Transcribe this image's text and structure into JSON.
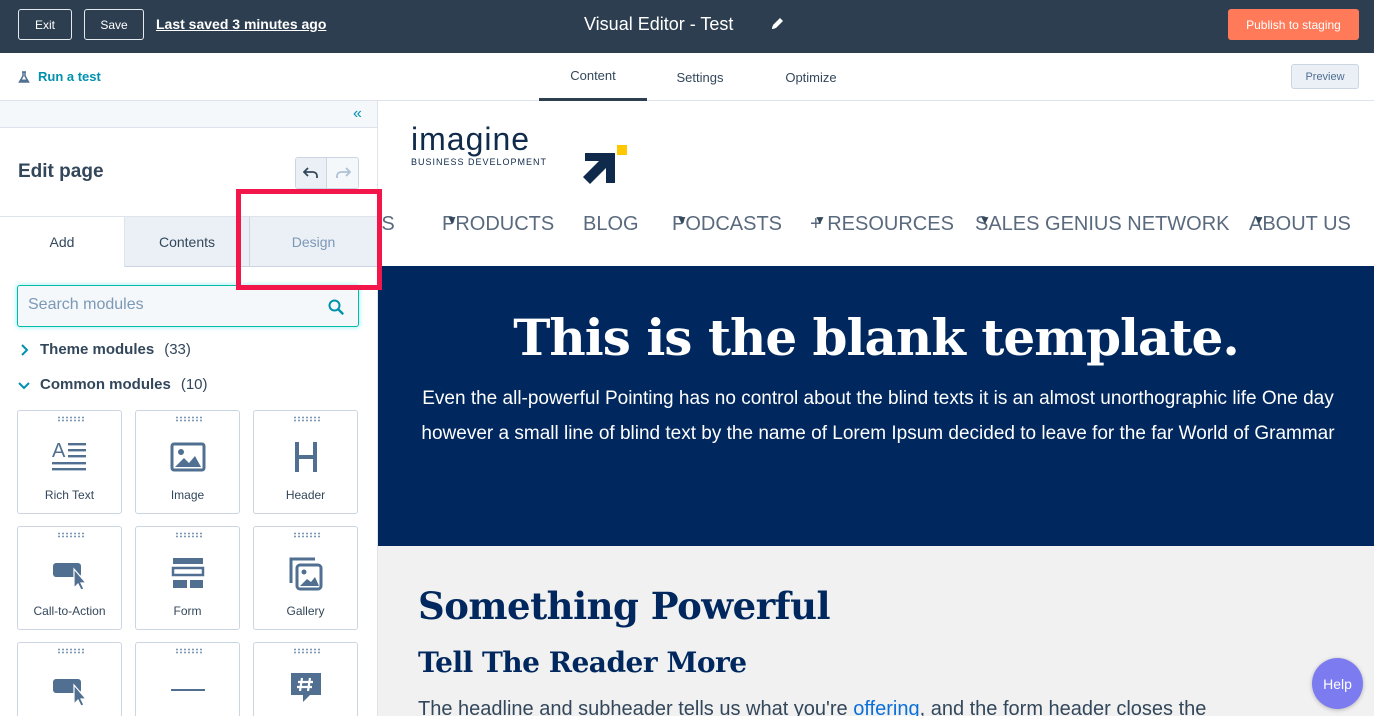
{
  "topbar": {
    "exit_label": "Exit",
    "save_label": "Save",
    "last_saved": "Last saved 3 minutes ago",
    "title": "Visual Editor - Test",
    "publish_label": "Publish to staging"
  },
  "subbar": {
    "run_test": "Run a test",
    "tabs": [
      {
        "label": "Content",
        "active": true
      },
      {
        "label": "Settings",
        "active": false
      },
      {
        "label": "Optimize",
        "active": false
      }
    ],
    "preview_label": "Preview"
  },
  "sidebar": {
    "heading": "Edit page",
    "tabs": [
      {
        "label": "Add",
        "active": true
      },
      {
        "label": "Contents",
        "active": false
      },
      {
        "label": "Design",
        "active": false
      }
    ],
    "search_placeholder": "Search modules",
    "groups": [
      {
        "label": "Theme modules",
        "count": "(33)",
        "expanded": false
      },
      {
        "label": "Common modules",
        "count": "(10)",
        "expanded": true
      }
    ],
    "modules": [
      {
        "label": "Rich Text",
        "icon": "rich-text-icon"
      },
      {
        "label": "Image",
        "icon": "image-icon"
      },
      {
        "label": "Header",
        "icon": "header-icon"
      },
      {
        "label": "Call-to-Action",
        "icon": "cta-icon"
      },
      {
        "label": "Form",
        "icon": "form-icon"
      },
      {
        "label": "Gallery",
        "icon": "gallery-icon"
      },
      {
        "label": "",
        "icon": "cta-icon"
      },
      {
        "label": "",
        "icon": "divider-icon"
      },
      {
        "label": "",
        "icon": "hashtag-chat-icon"
      }
    ]
  },
  "site": {
    "logo_word": "imagine",
    "logo_sub": "BUSINESS  DEVELOPMENT",
    "nav": [
      {
        "label": "ES",
        "dropdown": true
      },
      {
        "label": "PRODUCTS",
        "dropdown": true
      },
      {
        "label": "BLOG",
        "dropdown": false
      },
      {
        "label": "PODCASTS",
        "dropdown": true
      },
      {
        "label": "+ RESOURCES",
        "dropdown": true
      },
      {
        "label": "SALES GENIUS NETWORK",
        "dropdown": true
      },
      {
        "label": "ABOUT US",
        "dropdown": true
      }
    ],
    "hero_title": "This is the blank template.",
    "hero_text": "Even the all-powerful Pointing has no control about the blind texts it is an almost unorthographic life One day however a small line of blind text by the name of Lorem Ipsum decided to leave for the far World of Grammar",
    "section_title": "Something Powerful",
    "section_subtitle": "Tell The Reader More",
    "body_before": "The headline and subheader tells us what you're ",
    "body_link": "offering",
    "body_after": ", and the form header closes the"
  },
  "help_label": "Help",
  "colors": {
    "topbar": "#2d3e50",
    "publish": "#ff7a59",
    "accent": "#0091ae",
    "hero_bg": "#00285e",
    "highlight": "#f2164a",
    "help": "#7c7cf0"
  }
}
